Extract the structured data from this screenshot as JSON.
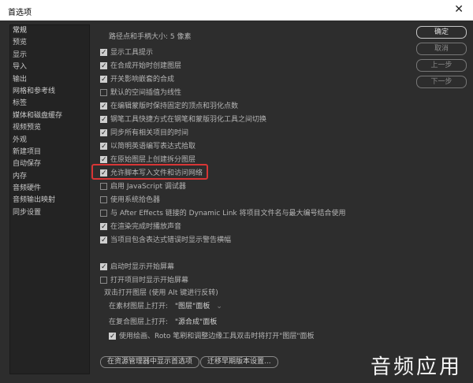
{
  "window": {
    "title": "首选项",
    "close_glyph": "✕"
  },
  "sidebar": {
    "items": [
      {
        "label": "常规",
        "selected": true
      },
      {
        "label": "预览"
      },
      {
        "label": "显示"
      },
      {
        "label": "导入"
      },
      {
        "label": "输出"
      },
      {
        "label": "网格和参考线"
      },
      {
        "label": "标签"
      },
      {
        "label": "媒体和磁盘缓存"
      },
      {
        "label": "视频预览"
      },
      {
        "label": "外观"
      },
      {
        "label": "新建项目"
      },
      {
        "label": "自动保存"
      },
      {
        "label": "内存"
      },
      {
        "label": "音频硬件"
      },
      {
        "label": "音频输出映射"
      },
      {
        "label": "同步设置"
      }
    ]
  },
  "general": {
    "path_hint": "路径点和手柄大小: 5 像素",
    "options": [
      {
        "label": "显示工具提示",
        "checked": true
      },
      {
        "label": "在合成开始时创建图层",
        "checked": true
      },
      {
        "label": "开关影响嵌套的合成",
        "checked": true
      },
      {
        "label": "默认的空间插值为线性",
        "checked": false
      },
      {
        "label": "在编辑蒙版时保持固定的顶点和羽化点数",
        "checked": true
      },
      {
        "label": "钢笔工具快捷方式在钢笔和蒙版羽化工具之间切换",
        "checked": true
      },
      {
        "label": "同步所有相关项目的时间",
        "checked": true
      },
      {
        "label": "以简明英语编写表达式拾取",
        "checked": true
      },
      {
        "label": "在原始图层上创建拆分图层",
        "checked": true
      },
      {
        "label": "允许脚本写入文件和访问网络",
        "checked": true
      },
      {
        "label": "启用 JavaScript 调试器",
        "checked": false
      },
      {
        "label": "使用系统拾色器",
        "checked": false
      },
      {
        "label": "与 After Effects 链接的 Dynamic Link 将项目文件名与最大编号结合使用",
        "checked": false
      },
      {
        "label": "在渲染完成时播放声音",
        "checked": true
      },
      {
        "label": "当项目包含表达式错误时显示警告横幅",
        "checked": true
      }
    ],
    "options2": [
      {
        "label": "启动时显示开始屏幕",
        "checked": true
      },
      {
        "label": "打开项目时显示开始屏幕",
        "checked": false
      }
    ],
    "double_click_label": "双击打开图层 (使用 Alt 键进行反转)",
    "footage_label": "在素材图层上打开:",
    "footage_value": "\"图层\"面板",
    "comp_label": "在复合图层上打开:",
    "comp_value": "\"源合成\"面板",
    "paint_option": {
      "label": "使用绘画、Roto 笔刷和调整边缘工具双击时将打开\"图层\"面板",
      "checked": true
    },
    "reveal_button": "在资源管理器中显示首选项",
    "migrate_button": "迁移早期版本设置..."
  },
  "buttons": {
    "ok": "确定",
    "cancel": "取消",
    "prev": "上一步",
    "next": "下一步"
  },
  "watermark": "音频应用",
  "colors": {
    "highlight": "#d83636",
    "background": "#2d2d2d",
    "sidebar": "#232323"
  }
}
